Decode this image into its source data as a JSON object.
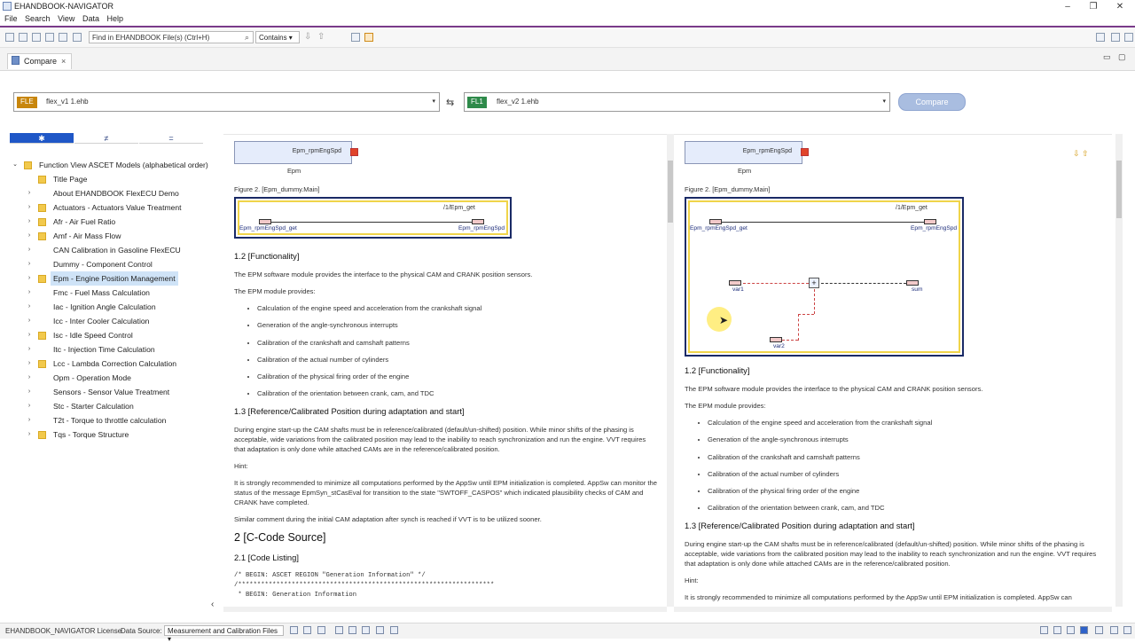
{
  "window": {
    "title": "EHANDBOOK-NAVIGATOR"
  },
  "menu": [
    "File",
    "Search",
    "View",
    "Data",
    "Help"
  ],
  "toolbar": {
    "find_placeholder": "Find in EHANDBOOK File(s) (Ctrl+H)",
    "contains_value": "Contains"
  },
  "tab": {
    "label": "Compare",
    "close": "×"
  },
  "compare": {
    "left_tag": "FLE",
    "left_tag_color": "#c8860c",
    "left_file": "flex_v1 1.ehb",
    "right_tag": "FL1",
    "right_tag_color": "#2e8a4a",
    "right_file": "flex_v2 1.ehb",
    "swap": "⇆",
    "button": "Compare"
  },
  "tree_tabs": [
    "✱",
    "≠",
    "="
  ],
  "tree": [
    {
      "label": "Function View ASCET Models (alphabetical order)",
      "level": 0,
      "chevron": "v"
    },
    {
      "label": "Title Page",
      "level": 1,
      "chevron": ""
    },
    {
      "label": "About EHANDBOOK FlexECU Demo",
      "level": 1,
      "chevron": ">",
      "noicon": true
    },
    {
      "label": "Actuators - Actuators Value Treatment",
      "level": 1,
      "chevron": ">"
    },
    {
      "label": "Afr - Air Fuel Ratio",
      "level": 1,
      "chevron": ">"
    },
    {
      "label": "Amf - Air Mass Flow",
      "level": 1,
      "chevron": ">"
    },
    {
      "label": "CAN Calibration in Gasoline FlexECU",
      "level": 1,
      "chevron": ">",
      "noicon": true
    },
    {
      "label": "Dummy - Component Control",
      "level": 1,
      "chevron": ">",
      "noicon": true
    },
    {
      "label": "Epm - Engine Position Management",
      "level": 1,
      "chevron": ">",
      "selected": true
    },
    {
      "label": "Fmc - Fuel Mass Calculation",
      "level": 1,
      "chevron": ">",
      "noicon": true
    },
    {
      "label": "Iac - Ignition Angle Calculation",
      "level": 1,
      "chevron": ">",
      "noicon": true
    },
    {
      "label": "Icc - Inter Cooler Calculation",
      "level": 1,
      "chevron": ">",
      "noicon": true
    },
    {
      "label": "Isc - Idle Speed Control",
      "level": 1,
      "chevron": ">"
    },
    {
      "label": "Itc - Injection Time Calculation",
      "level": 1,
      "chevron": ">",
      "noicon": true
    },
    {
      "label": "Lcc - Lambda Correction Calculation",
      "level": 1,
      "chevron": ">"
    },
    {
      "label": "Opm - Operation Mode",
      "level": 1,
      "chevron": ">",
      "noicon": true
    },
    {
      "label": "Sensors - Sensor Value Treatment",
      "level": 1,
      "chevron": ">",
      "noicon": true
    },
    {
      "label": "Stc - Starter Calculation",
      "level": 1,
      "chevron": ">",
      "noicon": true
    },
    {
      "label": "T2t - Torque to throttle calculation",
      "level": 1,
      "chevron": ">",
      "noicon": true
    },
    {
      "label": "Tqs - Torque Structure",
      "level": 1,
      "chevron": ">"
    }
  ],
  "doc": {
    "block_label": "Epm_rpmEngSpd",
    "block_caption": "Epm",
    "figure_caption": "Figure 2. [Epm_dummy.Main]",
    "diagram_title": "/1/Epm_get",
    "diagram_in": "Epm_rpmEngSpd_get",
    "diagram_out": "Epm_rpmEngSpd",
    "var1": "var1",
    "var2": "var2",
    "sum": "sum",
    "functionality_heading": "1.2 [Functionality]",
    "intro": "The EPM software module provides the interface to the physical CAM and CRANK position sensors.",
    "provides": "The EPM module provides:",
    "bullets": [
      "Calculation of the engine speed and acceleration from the crankshaft signal",
      "Generation of the angle-synchronous interrupts",
      "Calibration of the crankshaft and camshaft patterns",
      "Calibration of the actual number of cylinders",
      "Calibration of the physical firing order of the engine",
      "Calibration of the orientation between crank, cam, and TDC"
    ],
    "ref_heading": "1.3 [Reference/Calibrated Position during adaptation and start]",
    "ref_para": "During engine start-up the CAM shafts must be in reference/calibrated (default/un-shifted) position. While minor shifts of the phasing is acceptable, wide variations from the calibrated position may lead to the inability to reach synchronization and run the engine. VVT requires that adaptation is only done while attached CAMs are in the reference/calibrated position.",
    "hint": "Hint:",
    "hint_para": "It is strongly recommended to minimize all computations performed by the AppSw until EPM initialization is completed. AppSw can monitor the status of the message EpmSyn_stCasEval for transition to the state \"SWTOFF_CASPOS\" which indicated plausibility checks of CAM and CRANK have completed.",
    "similar_para": "Similar comment during the initial CAM adaptation after synch is reached if VVT is to be utilized sooner.",
    "ccode_heading": "2 [C-Code Source]",
    "listing_heading": "2.1 [Code Listing]",
    "code1": "/* BEGIN: ASCET REGION \"Generation Information\" */",
    "code2": "/*******************************************************************",
    "code3": " * BEGIN: Generation Information",
    "right_hint_trunc": "It is strongly recommended to minimize all computations performed by the AppSw until EPM initialization is completed. AppSw can"
  },
  "nav_arrows": "⇩ ⇧",
  "status": {
    "license": "EHANDBOOK_NAVIGATOR License",
    "data_source_label": "Data Source:",
    "data_source_value": "Measurement and Calibration Files"
  }
}
